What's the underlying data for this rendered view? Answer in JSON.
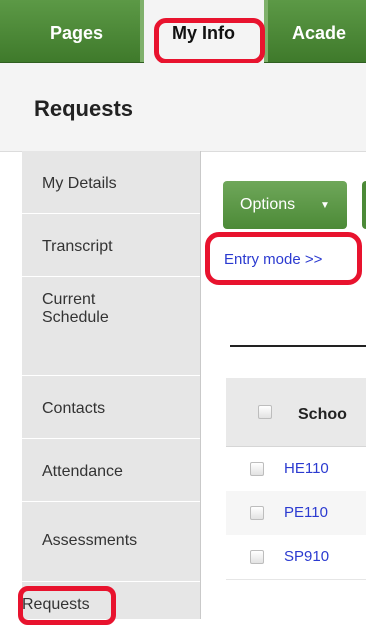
{
  "tabs": [
    {
      "label": "Pages"
    },
    {
      "label": "My Info"
    },
    {
      "label": "Acade"
    }
  ],
  "header": {
    "title": "Requests"
  },
  "sidebar": {
    "items": [
      {
        "label": "My Details"
      },
      {
        "label": "Transcript"
      },
      {
        "label": "Current Schedule"
      },
      {
        "label": "Contacts"
      },
      {
        "label": "Attendance"
      },
      {
        "label": "Assessments"
      },
      {
        "label": "Requests"
      }
    ]
  },
  "main": {
    "options_label": "Options",
    "options_caret": "▼",
    "entry_mode_label": "Entry mode >>",
    "table": {
      "header_school": "Schoo",
      "rows": [
        {
          "course": "HE110"
        },
        {
          "course": "PE110"
        },
        {
          "course": "SP910"
        }
      ]
    }
  },
  "colors": {
    "tab_green": "#3f7a2b",
    "highlight_red": "#e8132e",
    "link_blue": "#2b3ad0"
  }
}
